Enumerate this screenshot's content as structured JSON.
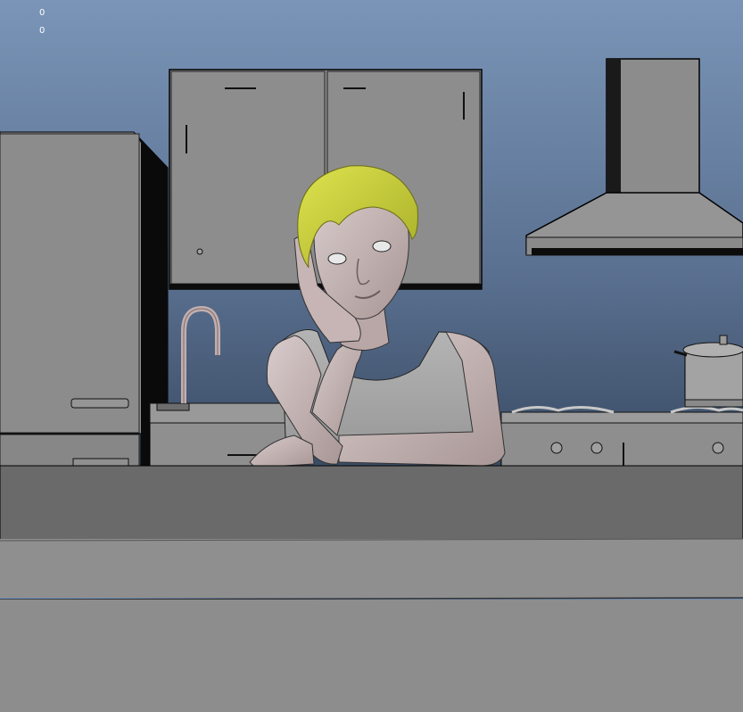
{
  "viewport": {
    "hud_values": [
      "0",
      "0"
    ]
  },
  "colors": {
    "sky_top": "#6f8bb0",
    "sky_bottom": "#3d4f68",
    "mesh_gray": "#8f8f8f",
    "mesh_light": "#a6a6a6",
    "mesh_dark": "#6a6a6a",
    "skin": "#c8b8b8",
    "hair": "#c8cf3a",
    "outline": "#000000"
  }
}
